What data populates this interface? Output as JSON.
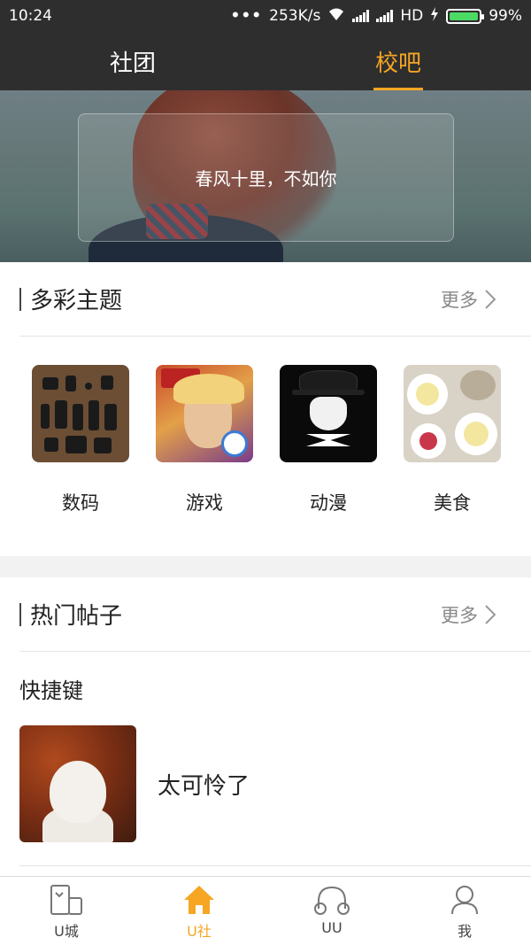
{
  "status_bar": {
    "time": "10:24",
    "dots": "•••",
    "speed": "253K/s",
    "network": "HD",
    "battery": "99%",
    "battery_level": 0.99
  },
  "top_tabs": [
    {
      "label": "社团",
      "active": false
    },
    {
      "label": "校吧",
      "active": true
    }
  ],
  "banner": {
    "caption": "春风十里，不如你"
  },
  "themes_section": {
    "title": "多彩主题",
    "more": "更多",
    "items": [
      {
        "label": "数码",
        "icon": "gadgets-image"
      },
      {
        "label": "游戏",
        "icon": "game-hero-image"
      },
      {
        "label": "动漫",
        "icon": "anime-character-image"
      },
      {
        "label": "美食",
        "icon": "food-plates-image"
      }
    ]
  },
  "hot_posts_section": {
    "title": "热门帖子",
    "more": "更多",
    "post": {
      "category": "快捷键",
      "text": "太可怜了",
      "icon": "dog-photo"
    }
  },
  "bottom_nav": [
    {
      "label": "U城",
      "icon": "city-icon",
      "active": false
    },
    {
      "label": "U社",
      "icon": "home-icon",
      "active": true
    },
    {
      "label": "UU",
      "icon": "headphones-icon",
      "active": false
    },
    {
      "label": "我",
      "icon": "person-icon",
      "active": false
    }
  ],
  "colors": {
    "accent": "#f6a623",
    "header_bg": "#2e2e2e"
  }
}
